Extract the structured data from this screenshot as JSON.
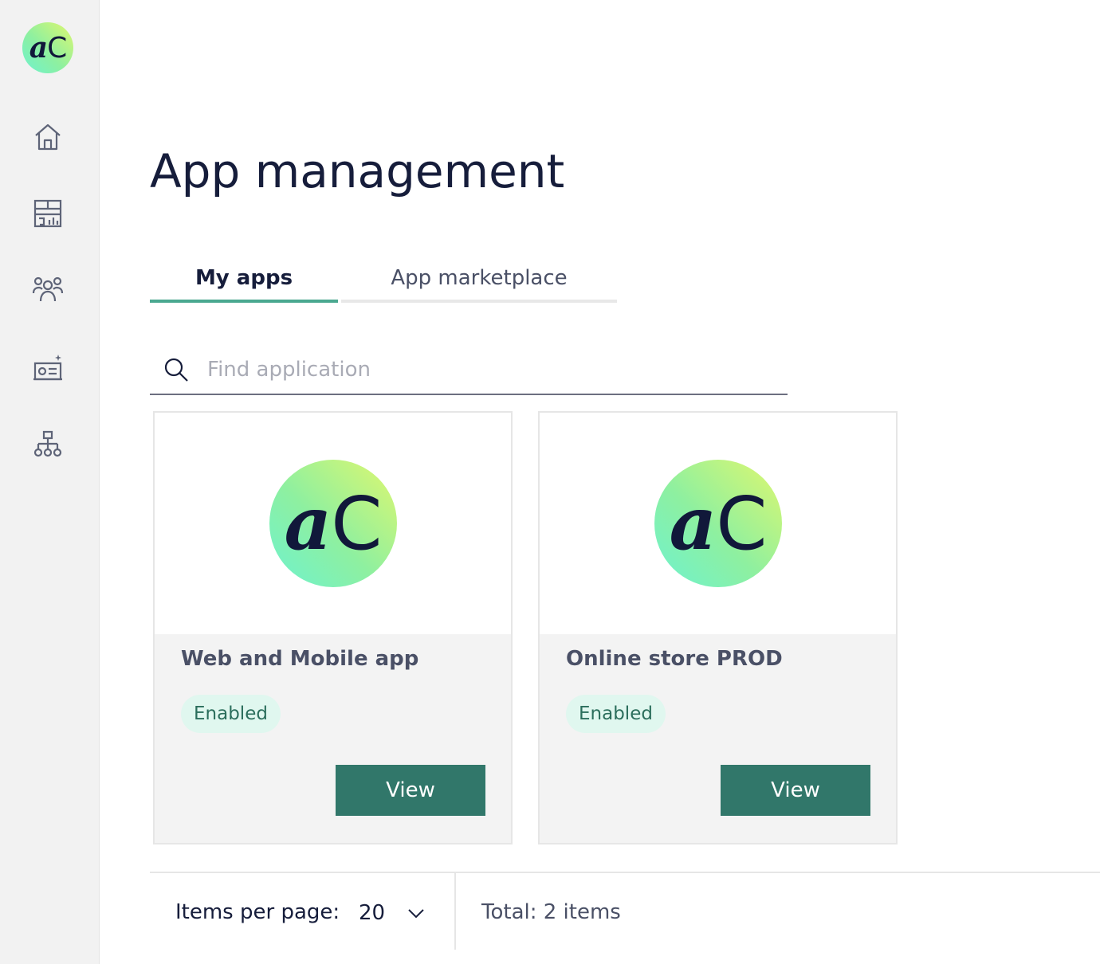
{
  "sidebar": {
    "logo": {
      "a": "a",
      "c": "C"
    },
    "items": [
      {
        "icon": "home-icon"
      },
      {
        "icon": "dashboard-icon"
      },
      {
        "icon": "users-icon"
      },
      {
        "icon": "campaign-icon"
      },
      {
        "icon": "hierarchy-icon"
      }
    ]
  },
  "page": {
    "title": "App management"
  },
  "tabs": [
    {
      "label": "My apps",
      "active": true
    },
    {
      "label": "App marketplace",
      "active": false
    }
  ],
  "search": {
    "placeholder": "Find application",
    "value": ""
  },
  "apps": [
    {
      "logo_a": "a",
      "logo_c": "C",
      "name": "Web and Mobile app",
      "status": "Enabled",
      "action": "View"
    },
    {
      "logo_a": "a",
      "logo_c": "C",
      "name": "Online store PROD",
      "status": "Enabled",
      "action": "View"
    }
  ],
  "footer": {
    "items_per_page_label": "Items per page:",
    "items_per_page_value": "20",
    "total": "Total: 2 items"
  },
  "colors": {
    "accent": "#4aa890",
    "button": "#31776a",
    "badge_bg": "#e0f7ef",
    "badge_text": "#2b6e5c"
  }
}
